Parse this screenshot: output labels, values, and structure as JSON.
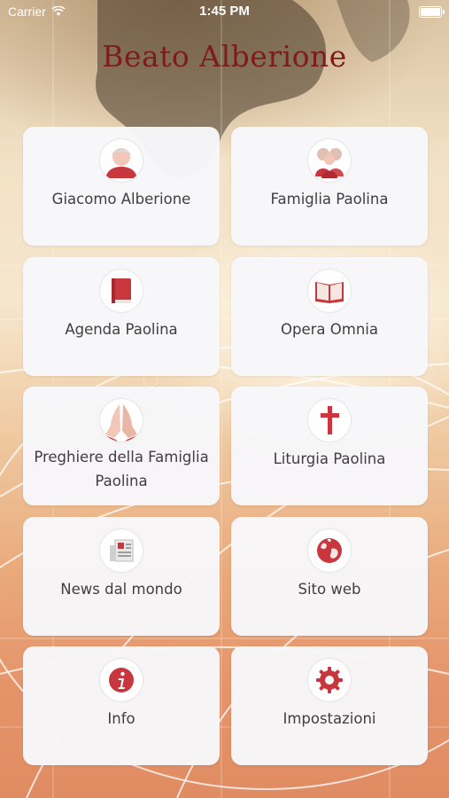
{
  "status_bar": {
    "carrier": "Carrier",
    "time": "1:45 PM",
    "battery_level": 1.0
  },
  "app": {
    "title": "Beato Alberione"
  },
  "menu": [
    {
      "label": "Giacomo Alberione",
      "icon": "person-bust-icon"
    },
    {
      "label": "Famiglia Paolina",
      "icon": "group-people-icon"
    },
    {
      "label": "Agenda Paolina",
      "icon": "book-icon"
    },
    {
      "label": "Opera Omnia",
      "icon": "open-book-icon"
    },
    {
      "label": "Preghiere della Famiglia Paolina",
      "icon": "praying-hands-icon"
    },
    {
      "label": "Liturgia Paolina",
      "icon": "cross-icon"
    },
    {
      "label": "News dal mondo",
      "icon": "newspaper-icon"
    },
    {
      "label": "Sito web",
      "icon": "globe-icon"
    },
    {
      "label": "Info",
      "icon": "info-icon"
    },
    {
      "label": "Impostazioni",
      "icon": "gear-icon"
    }
  ],
  "colors": {
    "accent": "#c8373d",
    "title": "#7d1c1a",
    "tile": "#f7f7fa",
    "label": "#3f3f3f"
  }
}
